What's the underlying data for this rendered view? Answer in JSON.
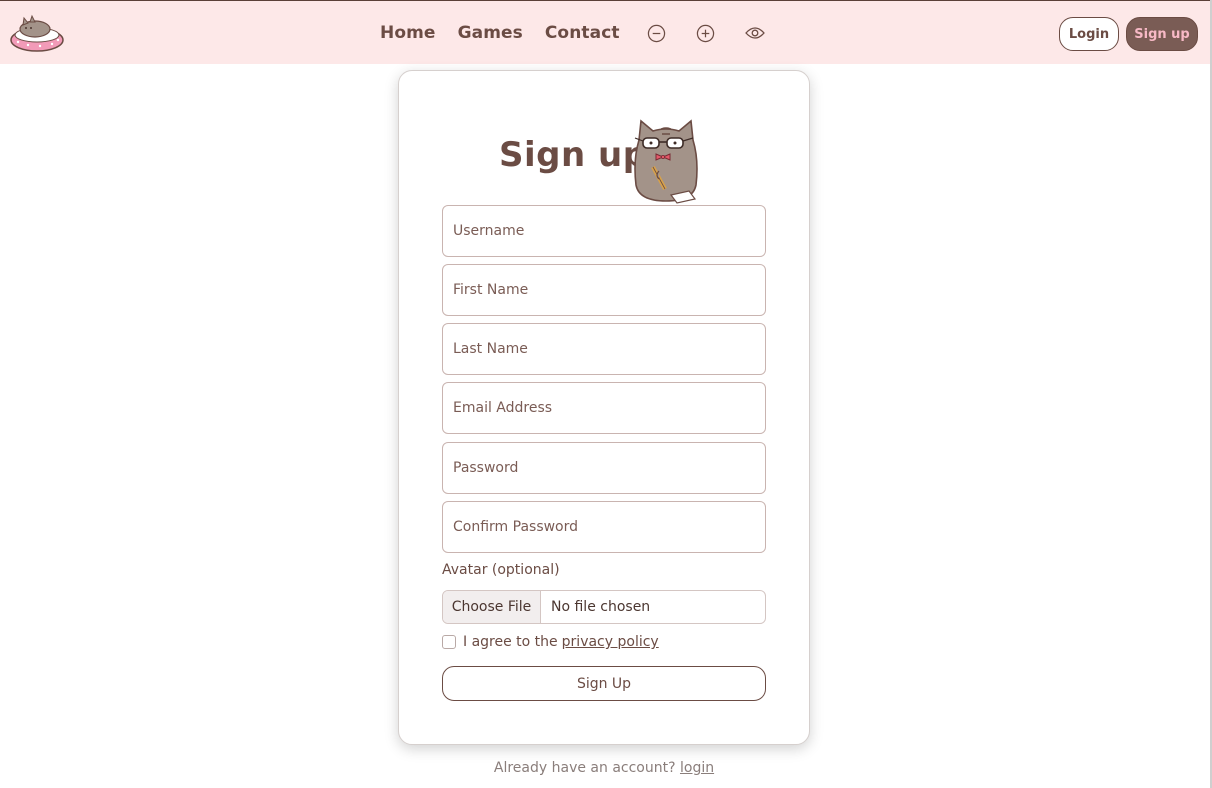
{
  "nav": {
    "links": [
      {
        "label": "Home"
      },
      {
        "label": "Games"
      },
      {
        "label": "Contact"
      }
    ],
    "icons": [
      "zoom-out-icon",
      "zoom-in-icon",
      "eye-icon"
    ],
    "login_label": "Login",
    "signup_label": "Sign up"
  },
  "form": {
    "title": "Sign up",
    "fields": {
      "username": "Username",
      "first_name": "First Name",
      "last_name": "Last Name",
      "email": "Email Address",
      "password": "Password",
      "confirm_password": "Confirm Password"
    },
    "avatar_label": "Avatar (optional)",
    "file_button": "Choose File",
    "file_status": "No file chosen",
    "agree_text": "I agree to the",
    "agree_link": "privacy policy",
    "submit_label": "Sign Up"
  },
  "footer": {
    "text": "Already have an account?",
    "link": "login"
  },
  "colors": {
    "navbar_bg": "#fde8e8",
    "brand_brown": "#6b4c44",
    "signup_button_bg": "#7a5c55",
    "signup_button_text": "#f7b9c6"
  }
}
